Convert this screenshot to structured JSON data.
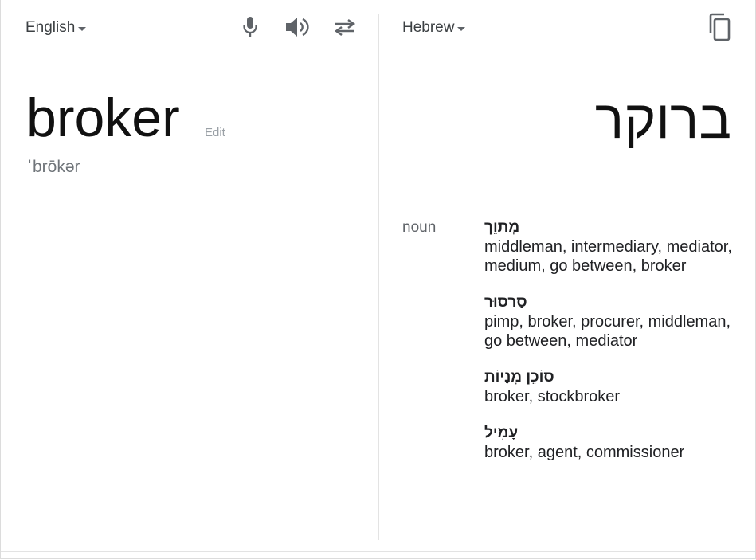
{
  "source": {
    "language": "English",
    "word": "broker",
    "edit_label": "Edit",
    "pronunciation": "ˈbrōkər",
    "icons": {
      "mic": "microphone-icon",
      "speaker": "speaker-icon",
      "swap": "swap-languages-icon"
    }
  },
  "target": {
    "language": "Hebrew",
    "word": "ברוקר",
    "icons": {
      "copy": "copy-icon"
    }
  },
  "dictionary": {
    "part_of_speech": "noun",
    "entries": [
      {
        "word": "מְתַוֵך",
        "synonyms": "middleman, intermediary, mediator, medium, go between, broker"
      },
      {
        "word": "סַרסוּר",
        "synonyms": "pimp, broker, procurer, middleman, go between, mediator"
      },
      {
        "word": "סוֹכֵן מְנָיוֹת",
        "synonyms": "broker, stockbroker"
      },
      {
        "word": "עָמִיל",
        "synonyms": "broker, agent, commissioner"
      }
    ]
  },
  "colors": {
    "icon": "#5f6368",
    "divider": "#e3e3e3",
    "muted_text": "#70757a"
  }
}
